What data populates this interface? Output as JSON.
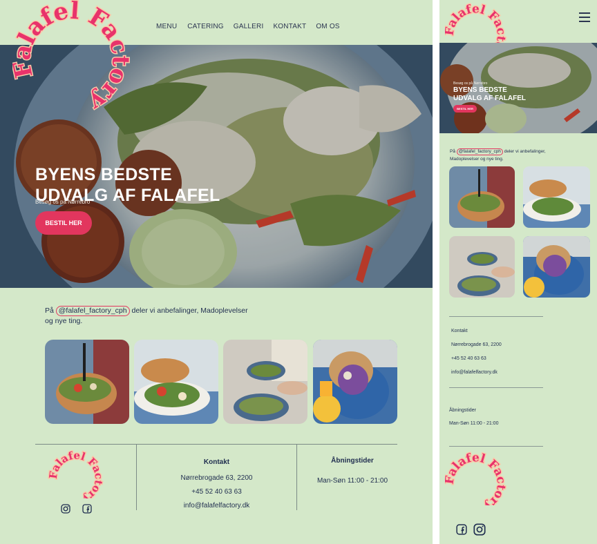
{
  "brand": {
    "name": "Falafel Factory",
    "primary": "#e2365e",
    "bg": "#d4e8c9",
    "text": "#1f2d4f"
  },
  "nav": {
    "items": [
      "MENU",
      "CATERING",
      "GALLERI",
      "KONTAKT",
      "OM OS"
    ]
  },
  "hero": {
    "subtitle": "Besøg os på Nørrebro",
    "title_line1": "BYENS BEDSTE",
    "title_line2": "UDVALG AF FALAFEL",
    "cta": "BESTIL HER"
  },
  "intro": {
    "prefix": "På",
    "handle": "@falafel_factory_cph",
    "suffix": "deler vi anbefalinger, Madoplevelser og nye ting."
  },
  "gallery": {
    "photos": [
      "salad-bowl-fork",
      "falafel-plate-bread",
      "bowls-hands-table",
      "pita-wrap-juice"
    ]
  },
  "footer": {
    "contact_title": "Kontakt",
    "address": "Nørrebrogade 63, 2200",
    "phone": "+45 52 40 63 63",
    "email": "info@falafelfactory.dk",
    "hours_title": "Åbningstider",
    "hours": "Man-Søn 11:00 - 21:00",
    "social": [
      "instagram-icon",
      "facebook-icon"
    ]
  }
}
